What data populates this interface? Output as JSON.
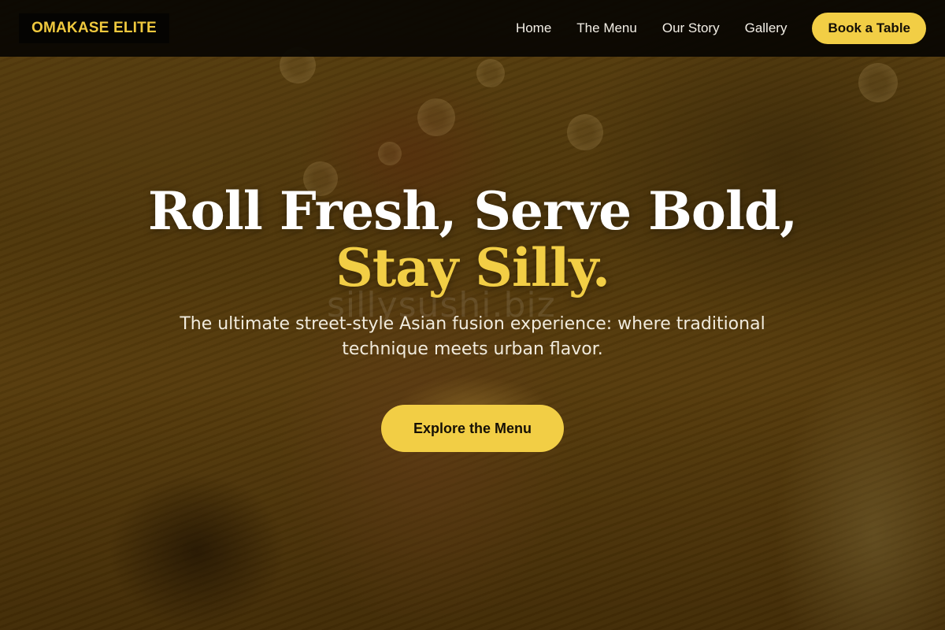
{
  "brand": {
    "logo_text": "OMAKASE ELITE"
  },
  "nav": {
    "links": [
      "Home",
      "The Menu",
      "Our Story",
      "Gallery"
    ],
    "cta_label": "Book a Table"
  },
  "hero": {
    "headline": "Roll Fresh, Serve Bold,",
    "headline_accent": "Stay Silly.",
    "subtitle": "The ultimate street-style Asian fusion experience: where traditional technique meets urban flavor.",
    "cta_label": "Explore the Menu",
    "watermark": "sillysushi.biz"
  },
  "colors": {
    "accent": "#f2ce45",
    "nav_background": "#080602",
    "text_light": "#ffffff"
  }
}
